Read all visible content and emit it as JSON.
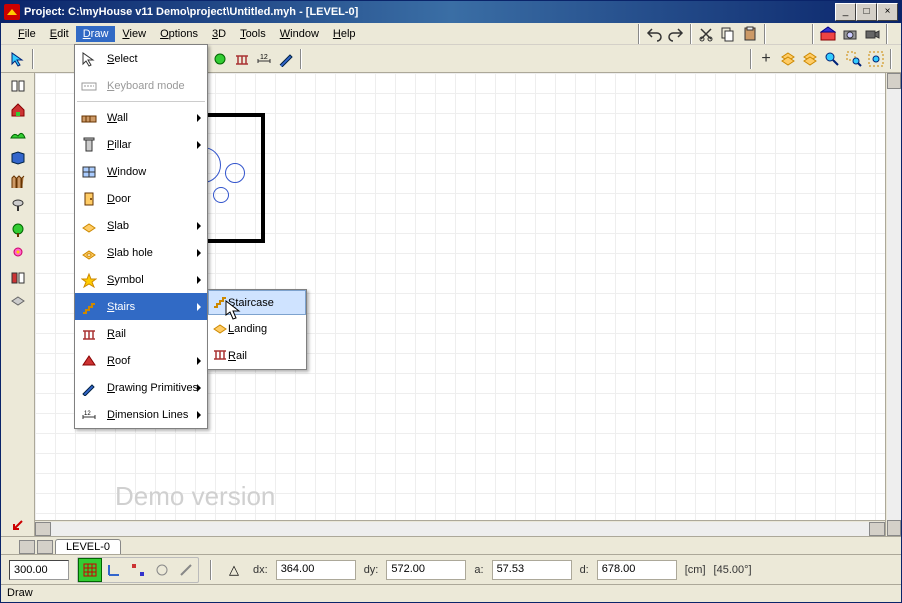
{
  "title": "Project: C:\\myHouse v11 Demo\\project\\Untitled.myh - [LEVEL-0]",
  "menubar": [
    "File",
    "Edit",
    "Draw",
    "View",
    "Options",
    "3D",
    "Tools",
    "Window",
    "Help"
  ],
  "open_menu_index": 2,
  "draw_menu": {
    "items": [
      {
        "label": "Select",
        "icon": "cursor",
        "has_sub": false
      },
      {
        "label": "Keyboard mode",
        "icon": "keyboard",
        "disabled": true
      },
      {
        "sep": true
      },
      {
        "label": "Wall",
        "icon": "wall",
        "has_sub": true
      },
      {
        "label": "Pillar",
        "icon": "pillar",
        "has_sub": true
      },
      {
        "label": "Window",
        "icon": "window",
        "has_sub": false
      },
      {
        "label": "Door",
        "icon": "door",
        "has_sub": false
      },
      {
        "label": "Slab",
        "icon": "slab",
        "has_sub": true
      },
      {
        "label": "Slab hole",
        "icon": "slabhole",
        "has_sub": true
      },
      {
        "label": "Symbol",
        "icon": "symbol",
        "has_sub": true
      },
      {
        "label": "Stairs",
        "icon": "stairs",
        "has_sub": true,
        "open": true
      },
      {
        "label": "Rail",
        "icon": "rail",
        "has_sub": false
      },
      {
        "label": "Roof",
        "icon": "roof",
        "has_sub": true
      },
      {
        "label": "Drawing Primitives",
        "icon": "pencil",
        "has_sub": true
      },
      {
        "label": "Dimension Lines",
        "icon": "dim",
        "has_sub": true
      }
    ]
  },
  "stairs_submenu": [
    {
      "label": "Staircase",
      "icon": "staircase",
      "highlight": true
    },
    {
      "label": "Landing",
      "icon": "landing"
    },
    {
      "label": "Rail",
      "icon": "rail"
    }
  ],
  "watermark": "Demo version",
  "level_tab": "LEVEL-0",
  "status_input": "300.00",
  "dx_label": "dx:",
  "dx": "364.00",
  "dy_label": "dy:",
  "dy": "572.00",
  "a_label": "a:",
  "a": "57.53",
  "d_label": "d:",
  "d": "678.00",
  "unit": "[cm]",
  "angle": "[45.00°]",
  "status_bottom": "Draw"
}
